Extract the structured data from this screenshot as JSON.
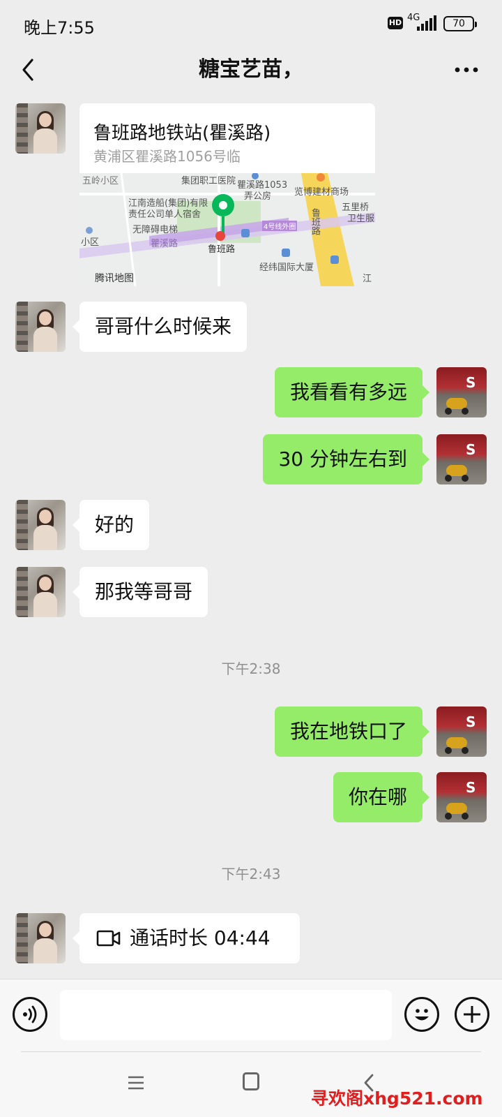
{
  "status_bar": {
    "time": "晚上7:55",
    "hd": "HD",
    "network": "4G",
    "battery": "70"
  },
  "header": {
    "title": "糖宝艺苗，",
    "back_icon": "chevron-left-icon",
    "more_icon": "more-dots-icon"
  },
  "location": {
    "name": "鲁班路地铁站(瞿溪路)",
    "address": "黄浦区瞿溪路1056号临",
    "map_labels": {
      "wuling": "五岭小区",
      "hospital": "集团职工医院",
      "quxi1053": "瞿溪路1053",
      "nongong": "弄公房",
      "jiancai": "览博建材商场",
      "wuliqiao": "五里桥",
      "weisheng": "卫生服",
      "jiangnan1": "江南造船(集团)有限",
      "jiangnan2": "责任公司单人宿舍",
      "elevator": "无障碍电梯",
      "line4": "4号线外圈",
      "luban_road_v": "鲁班路",
      "xiaoqu": "小区",
      "luban_station": "鲁班路",
      "quxi_road": "瞿溪路",
      "jingwei": "经纬国际大厦",
      "jiang": "江",
      "tencent": "腾讯地图"
    }
  },
  "messages": [
    {
      "side": "left",
      "text": "哥哥什么时候来"
    },
    {
      "side": "right",
      "text": "我看看有多远"
    },
    {
      "side": "right",
      "text": "30 分钟左右到"
    },
    {
      "side": "left",
      "text": "好的"
    },
    {
      "side": "left",
      "text": "那我等哥哥"
    },
    {
      "side": "right",
      "text": "我在地铁口了"
    },
    {
      "side": "right",
      "text": "你在哪"
    }
  ],
  "timestamps": [
    "下午2:38",
    "下午2:43"
  ],
  "call": {
    "icon": "video-call-icon",
    "text": "通话时长 04:44"
  },
  "input_bar": {
    "voice_icon": "voice-icon",
    "emoji_icon": "emoji-icon",
    "plus_icon": "plus-icon",
    "placeholder": ""
  },
  "watermark": "寻欢阁xhg521.com",
  "colors": {
    "background": "#ededed",
    "my_bubble": "#95ec69",
    "their_bubble": "#ffffff",
    "watermark": "#e01e1e"
  }
}
